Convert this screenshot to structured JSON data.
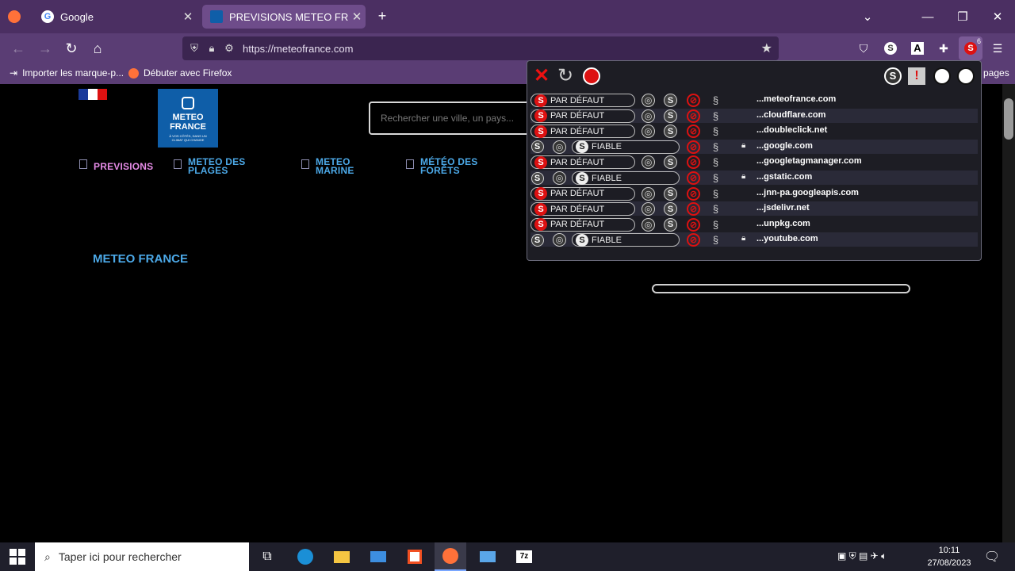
{
  "browser": {
    "tabs": [
      {
        "label": "Google",
        "favicon_color": "#4285f4"
      },
      {
        "label": "PREVISIONS METEO FRANCE - S",
        "favicon_color": "#0f5ea8"
      }
    ],
    "new_tab": "+",
    "url": "https://meteofrance.com",
    "bookmarks": [
      {
        "label": "Importer les marque-p..."
      },
      {
        "label": "Débuter avec Firefox"
      }
    ],
    "overflow_bookmark": "pages",
    "noscript_badge": "6",
    "accent": "#4b2f62"
  },
  "page": {
    "logo_lines": [
      "METEO",
      "FRANCE"
    ],
    "logo_tagline": "À VOS CÔTÉS, DANS UN CLIMAT QUI CHANGE",
    "search_placeholder": "Rechercher une ville, un pays...",
    "menu": [
      {
        "line1": "PREVISIONS",
        "line2": ""
      },
      {
        "line1": "METEO DES",
        "line2": "PLAGES"
      },
      {
        "line1": "METEO",
        "line2": "MARINE"
      },
      {
        "line1": "MÉTÉO DES",
        "line2": "FORÊTS"
      }
    ],
    "brand_title": "METEO FRANCE"
  },
  "noscript": {
    "rows": [
      {
        "preset": "PAR DÉFAUT",
        "trusted": false,
        "https_lock": false,
        "domain": "...meteofrance.com"
      },
      {
        "preset": "PAR DÉFAUT",
        "trusted": false,
        "https_lock": false,
        "domain": "...cloudflare.com"
      },
      {
        "preset": "PAR DÉFAUT",
        "trusted": false,
        "https_lock": false,
        "domain": "...doubleclick.net"
      },
      {
        "preset": "FIABLE",
        "trusted": true,
        "https_lock": true,
        "domain": "...google.com"
      },
      {
        "preset": "PAR DÉFAUT",
        "trusted": false,
        "https_lock": false,
        "domain": "...googletagmanager.com"
      },
      {
        "preset": "FIABLE",
        "trusted": true,
        "https_lock": true,
        "domain": "...gstatic.com"
      },
      {
        "preset": "PAR DÉFAUT",
        "trusted": false,
        "https_lock": false,
        "domain": "...jnn-pa.googleapis.com"
      },
      {
        "preset": "PAR DÉFAUT",
        "trusted": false,
        "https_lock": false,
        "domain": "...jsdelivr.net"
      },
      {
        "preset": "PAR DÉFAUT",
        "trusted": false,
        "https_lock": false,
        "domain": "...unpkg.com"
      },
      {
        "preset": "FIABLE",
        "trusted": true,
        "https_lock": true,
        "domain": "...youtube.com"
      }
    ]
  },
  "taskbar": {
    "search_placeholder": "Taper ici pour rechercher",
    "time": "10:11",
    "date": "27/08/2023"
  }
}
